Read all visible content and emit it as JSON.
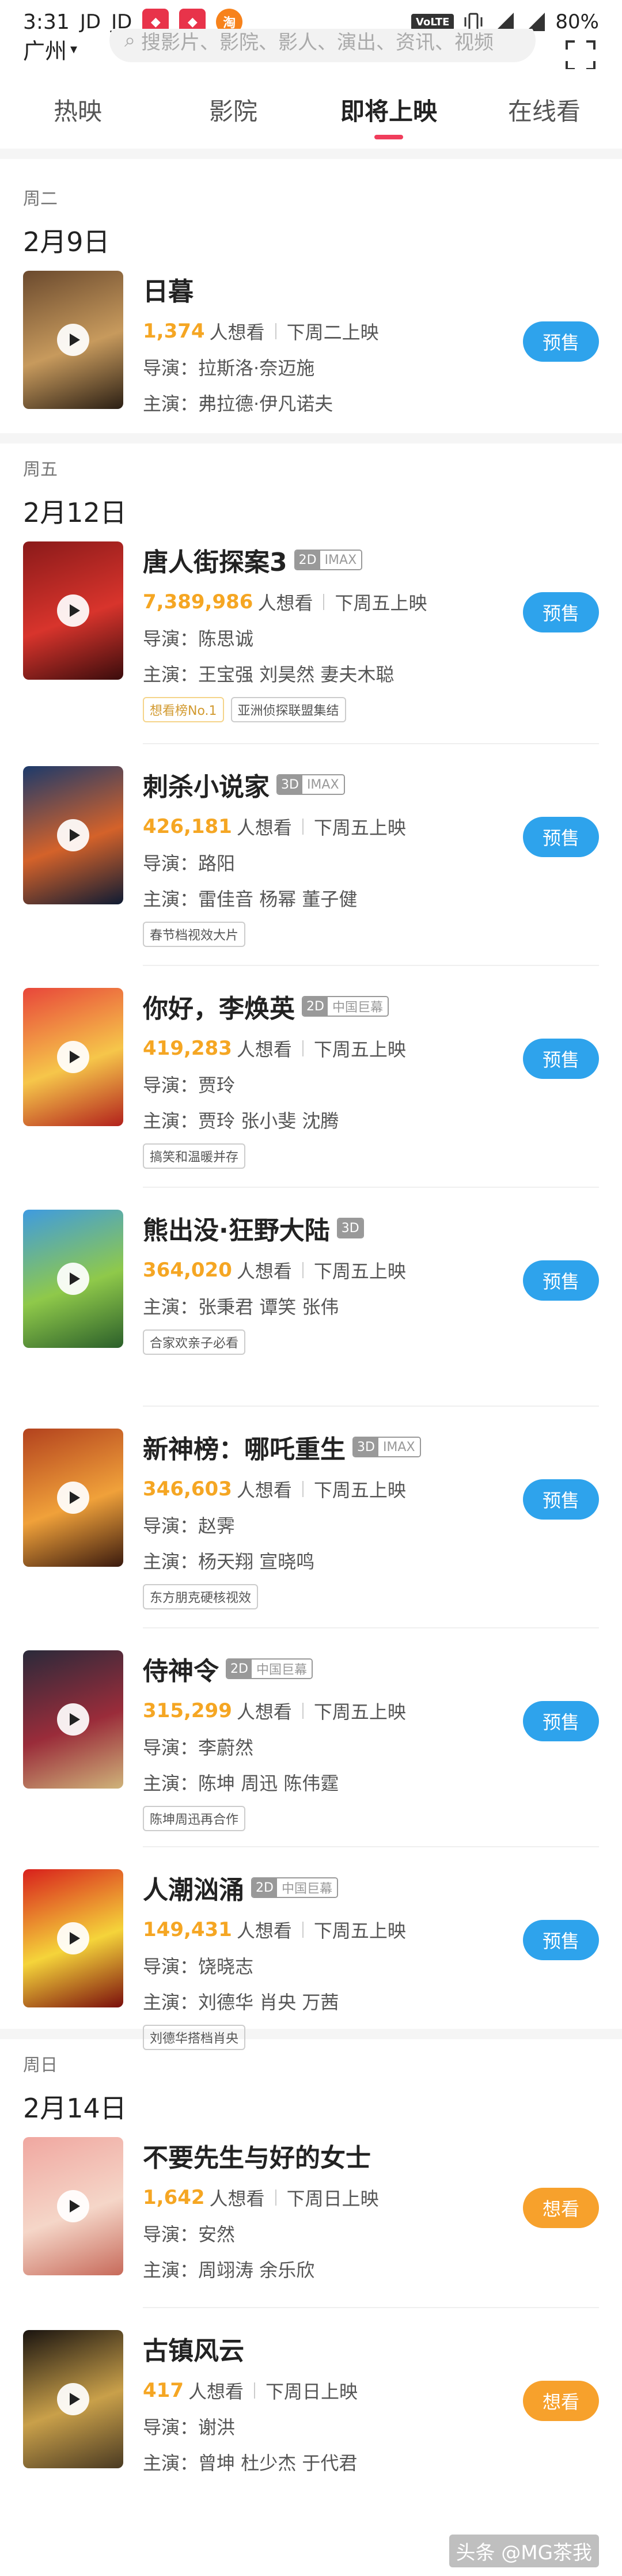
{
  "status_bar": {
    "time": "3:31",
    "app_icons": [
      "JD",
      "JD"
    ],
    "volte": "VoLTE",
    "battery": "80%"
  },
  "search": {
    "city": "广州",
    "placeholder": "搜影片、影院、影人、演出、资讯、视频"
  },
  "tabs": [
    {
      "label": "热映",
      "active": false
    },
    {
      "label": "影院",
      "active": false
    },
    {
      "label": "即将上映",
      "active": true
    },
    {
      "label": "在线看",
      "active": false
    }
  ],
  "days": [
    {
      "week": "周二",
      "date": "2月9日"
    },
    {
      "week": "周五",
      "date": "2月12日"
    },
    {
      "week": "周日",
      "date": "2月14日"
    }
  ],
  "want_suffix": "人想看",
  "director_prefix": "导演：",
  "cast_prefix": "主演：",
  "movies": [
    {
      "title": "日暮",
      "badges": [],
      "want": "1,374",
      "release": "下周二上映",
      "director": "拉斯洛·奈迈施",
      "cast": "弗拉德·伊凡诺夫",
      "tags": [],
      "action": "预售",
      "poster_colors": [
        "#6b4a2e",
        "#c79a5d",
        "#2b1f14"
      ]
    },
    {
      "title": "唐人街探案3",
      "badges": [
        [
          "2D",
          "IMAX"
        ]
      ],
      "want": "7,389,986",
      "release": "下周五上映",
      "director": "陈思诚",
      "cast": "王宝强 刘昊然 妻夫木聪",
      "tags": [
        [
          "想看榜No.1",
          true
        ],
        [
          "亚洲侦探联盟集结",
          false
        ]
      ],
      "action": "预售",
      "poster_colors": [
        "#8a1a1a",
        "#d8342c",
        "#3a0c0c"
      ]
    },
    {
      "title": "刺杀小说家",
      "badges": [
        [
          "3D",
          "IMAX"
        ]
      ],
      "want": "426,181",
      "release": "下周五上映",
      "director": "路阳",
      "cast": "雷佳音 杨幂 董子健",
      "tags": [
        [
          "春节档视效大片",
          false
        ]
      ],
      "action": "预售",
      "poster_colors": [
        "#1c3a6b",
        "#d4622a",
        "#0e1b33"
      ]
    },
    {
      "title": "你好，李焕英",
      "badges": [
        [
          "2D",
          "中国巨幕"
        ]
      ],
      "want": "419,283",
      "release": "下周五上映",
      "director": "贾玲",
      "cast": "贾玲 张小斐 沈腾",
      "tags": [
        [
          "搞笑和温暖并存",
          false
        ]
      ],
      "action": "预售",
      "poster_colors": [
        "#e8463a",
        "#f6c64a",
        "#b2211c"
      ]
    },
    {
      "title": "熊出没·狂野大陆",
      "badges": [
        [
          "3D",
          ""
        ]
      ],
      "want": "364,020",
      "release": "下周五上映",
      "director": "",
      "cast": "张秉君 谭笑 张伟",
      "tags": [
        [
          "合家欢亲子必看",
          false
        ]
      ],
      "action": "预售",
      "poster_colors": [
        "#3f9be0",
        "#8fc94a",
        "#2b5f2a"
      ]
    },
    {
      "title": "新神榜：哪吒重生",
      "badges": [
        [
          "3D",
          "IMAX"
        ]
      ],
      "want": "346,603",
      "release": "下周五上映",
      "director": "赵霁",
      "cast": "杨天翔 宣晓鸣",
      "tags": [
        [
          "东方朋克硬核视效",
          false
        ]
      ],
      "action": "预售",
      "poster_colors": [
        "#b3421e",
        "#f0a13a",
        "#3a1a0e"
      ]
    },
    {
      "title": "侍神令",
      "badges": [
        [
          "2D",
          "中国巨幕"
        ]
      ],
      "want": "315,299",
      "release": "下周五上映",
      "director": "李蔚然",
      "cast": "陈坤 周迅 陈伟霆",
      "tags": [
        [
          "陈坤周迅再合作",
          false
        ]
      ],
      "action": "预售",
      "poster_colors": [
        "#2a2a3a",
        "#9a2c3a",
        "#cfb37a"
      ]
    },
    {
      "title": "人潮汹涌",
      "badges": [
        [
          "2D",
          "中国巨幕"
        ]
      ],
      "want": "149,431",
      "release": "下周五上映",
      "director": "饶晓志",
      "cast": "刘德华 肖央 万茜",
      "tags": [
        [
          "刘德华搭档肖央",
          false
        ]
      ],
      "action": "预售",
      "poster_colors": [
        "#d8201c",
        "#f5d43a",
        "#7a0e0c"
      ]
    },
    {
      "title": "不要先生与好的女士",
      "badges": [],
      "want": "1,642",
      "release": "下周日上映",
      "director": "安然",
      "cast": "周翊涛 余乐欣",
      "tags": [],
      "action": "想看",
      "poster_colors": [
        "#f0a7a0",
        "#f5d6c8",
        "#c76a5a"
      ]
    },
    {
      "title": "古镇风云",
      "badges": [],
      "want": "417",
      "release": "下周日上映",
      "director": "谢洪",
      "cast": "曾坤 杜少杰 于代君",
      "tags": [],
      "action": "想看",
      "poster_colors": [
        "#1a1410",
        "#c9a04a",
        "#4a3a22"
      ]
    }
  ],
  "watermark": "头条 @MG茶我"
}
